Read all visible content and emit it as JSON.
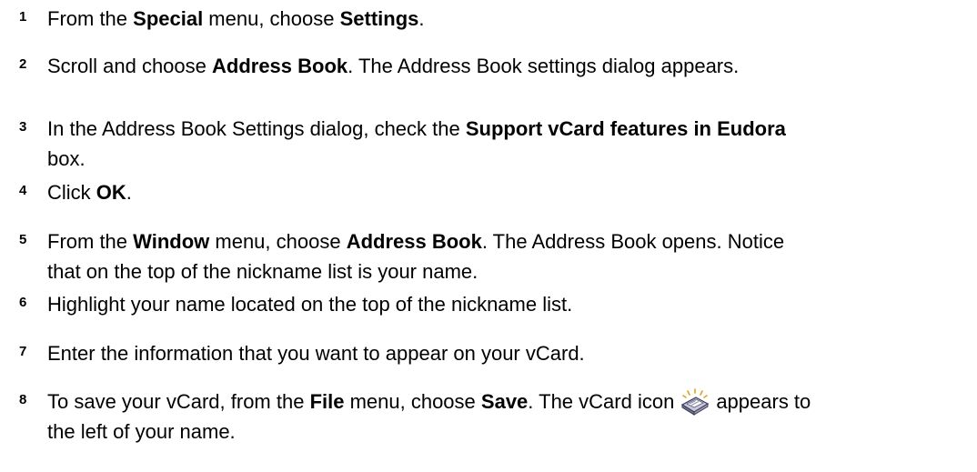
{
  "steps": [
    {
      "number": "1",
      "parts": [
        {
          "t": "From the "
        },
        {
          "b": "Special"
        },
        {
          "t": " menu, choose "
        },
        {
          "b": "Settings"
        },
        {
          "t": "."
        }
      ]
    },
    {
      "number": "2",
      "parts": [
        {
          "t": "Scroll and choose "
        },
        {
          "b": "Address Book"
        },
        {
          "t": ". The Address Book settings dialog appears."
        }
      ]
    },
    {
      "number": "3",
      "parts": [
        {
          "t": "In the Address Book Settings dialog, check the "
        },
        {
          "b": "Support vCard features in Eudora"
        },
        {
          "br": true
        },
        {
          "t": "box."
        }
      ]
    },
    {
      "number": "4",
      "parts": [
        {
          "t": "Click "
        },
        {
          "b": "OK"
        },
        {
          "t": "."
        }
      ]
    },
    {
      "number": "5",
      "parts": [
        {
          "t": "From the "
        },
        {
          "b": "Window"
        },
        {
          "t": " menu, choose "
        },
        {
          "b": "Address Book"
        },
        {
          "t": ". The Address Book opens. Notice"
        },
        {
          "br": true
        },
        {
          "t": "that on the top of the nickname list is your name."
        }
      ]
    },
    {
      "number": "6",
      "parts": [
        {
          "t": "Highlight your name located on the top of the nickname list."
        }
      ]
    },
    {
      "number": "7",
      "parts": [
        {
          "t": "Enter the information that you want to appear on your vCard."
        }
      ]
    },
    {
      "number": "8",
      "parts": [
        {
          "t": "To save your vCard, from the "
        },
        {
          "b": "File"
        },
        {
          "t": " menu, choose "
        },
        {
          "b": "Save"
        },
        {
          "t": ". The vCard icon"
        },
        {
          "icon": "vcard-icon"
        },
        {
          "t": "appears to"
        },
        {
          "br": true
        },
        {
          "t": "the left of your name."
        }
      ]
    }
  ]
}
